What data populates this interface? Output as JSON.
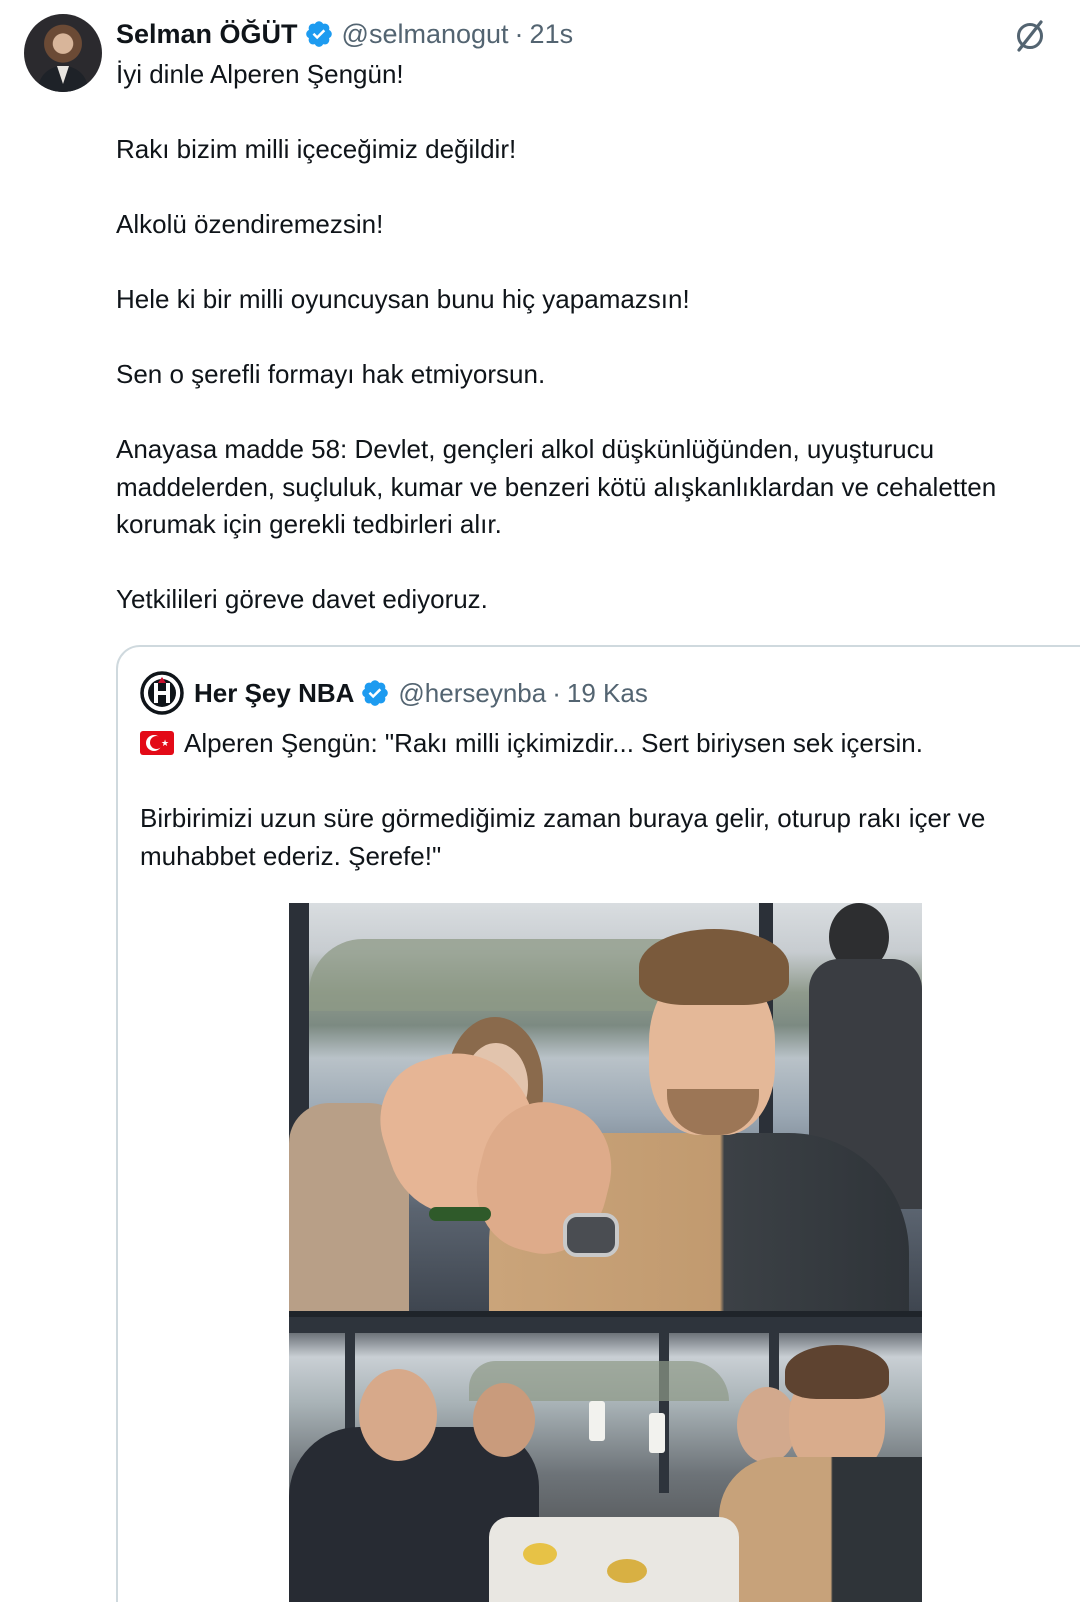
{
  "tweet": {
    "author_name": "Selman ÖĞÜT",
    "author_handle": "@selmanogut",
    "separator": "·",
    "timestamp": "21s",
    "verified_color": "#1d9bf0",
    "text": "İyi dinle Alperen Şengün!\n\nRakı bizim milli içeceğimiz değildir!\n\nAlkolü özendiremezsin!\n\nHele ki bir milli oyuncuysan bunu hiç yapamazsın!\n\nSen o şerefli formayı hak etmiyorsun.\n\nAnayasa madde 58: Devlet, gençleri alkol düşkünlüğünden, uyuşturucu maddelerden, suçluluk, kumar ve benzeri kötü alışkanlıklardan ve cehaletten korumak için gerekli tedbirleri alır.\n\nYetkilileri göreve davet ediyoruz.",
    "icons": {
      "verified": "verified-badge-icon",
      "grok": "grok-icon"
    }
  },
  "quoted": {
    "author_name": "Her Şey NBA",
    "author_handle": "@herseynba",
    "separator": "·",
    "timestamp": "19 Kas",
    "flag_icon": "turkey-flag-icon",
    "line1": "Alperen Şengün: \"Rakı milli içkimizdir... Sert biriysen sek içersin.",
    "line2": "Birbirimizi uzun süre görmediğimiz zaman buraya gelir, oturup rakı içer ve muhabbet ederiz. Şerefe!\""
  }
}
